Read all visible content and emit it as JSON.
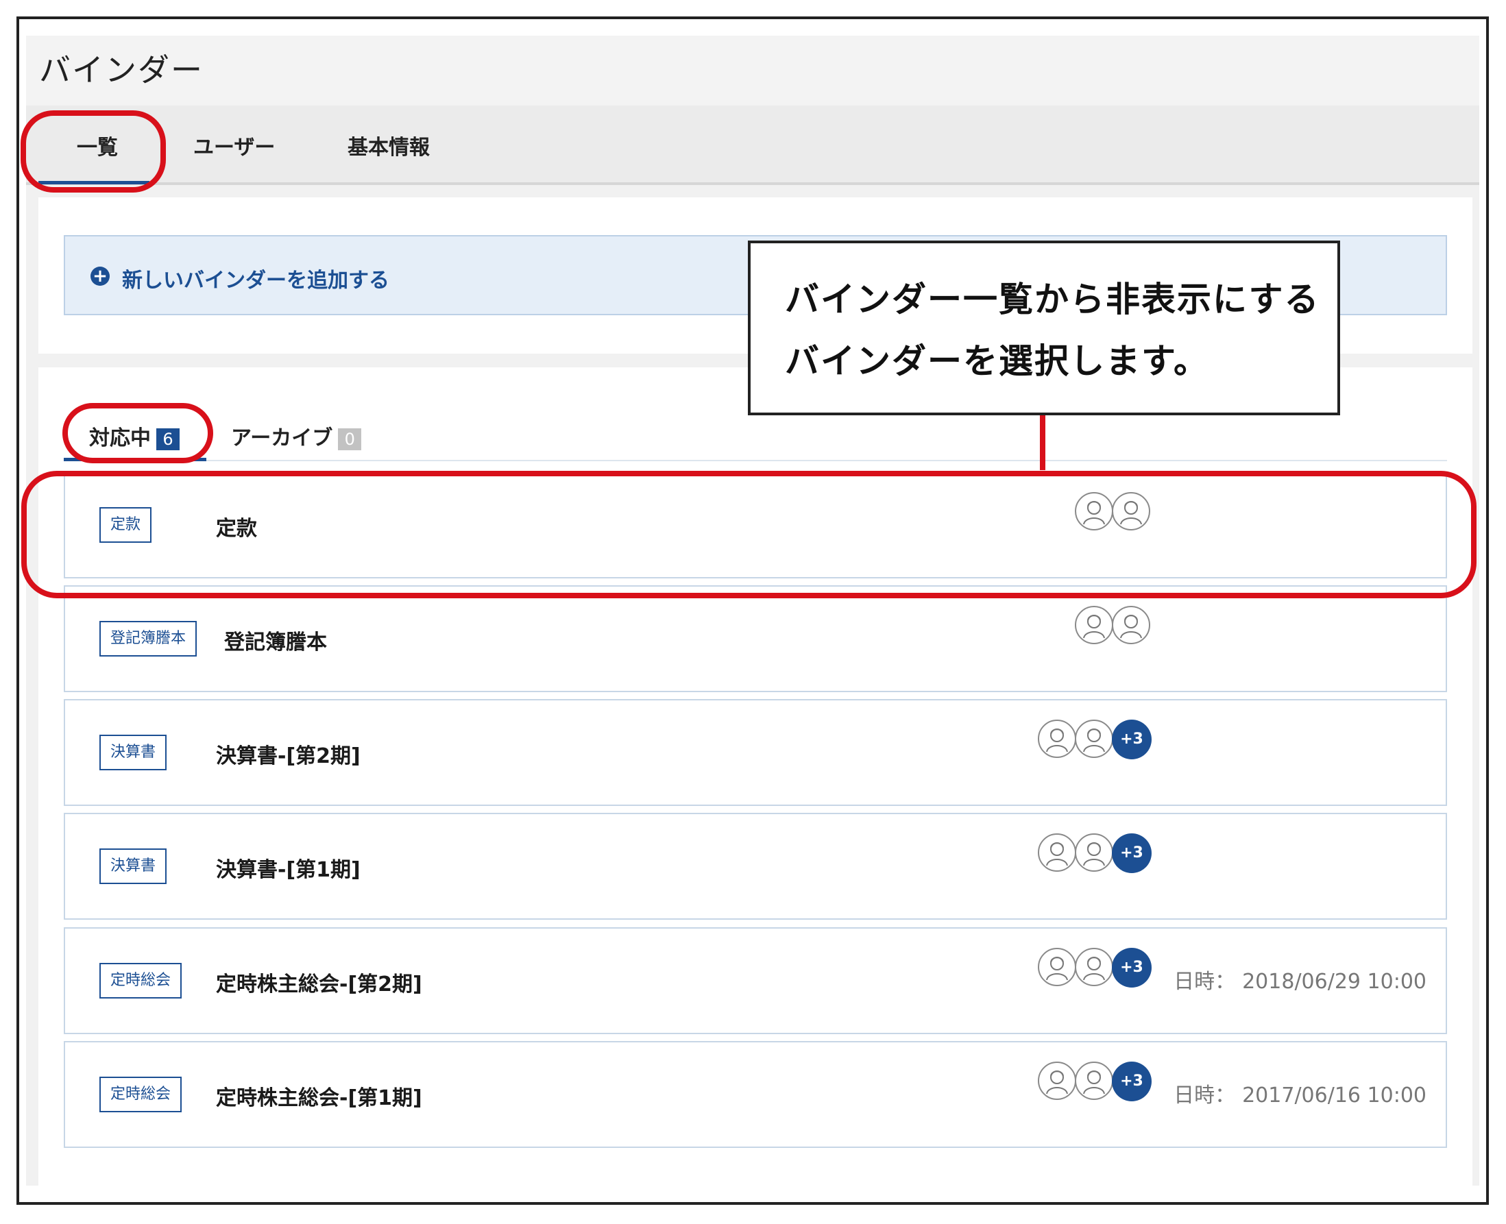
{
  "page": {
    "title": "バインダー"
  },
  "tabs": [
    {
      "label": "一覧",
      "active": true
    },
    {
      "label": "ユーザー",
      "active": false
    },
    {
      "label": "基本情報",
      "active": false
    }
  ],
  "add_binder": {
    "label": "新しいバインダーを追加する",
    "icon": "plus-circle-icon"
  },
  "subtabs": [
    {
      "label": "対応中",
      "count": "6",
      "active": true
    },
    {
      "label": "アーカイブ",
      "count": "0",
      "active": false
    }
  ],
  "binders": [
    {
      "tag": "定款",
      "title": "定款",
      "avatars": 2,
      "more": "",
      "date_label": "",
      "date": ""
    },
    {
      "tag": "登記簿謄本",
      "title": "登記簿謄本",
      "avatars": 2,
      "more": "",
      "date_label": "",
      "date": ""
    },
    {
      "tag": "決算書",
      "title": "決算書-[第2期]",
      "avatars": 2,
      "more": "+3",
      "date_label": "",
      "date": ""
    },
    {
      "tag": "決算書",
      "title": "決算書-[第1期]",
      "avatars": 2,
      "more": "+3",
      "date_label": "",
      "date": ""
    },
    {
      "tag": "定時総会",
      "title": "定時株主総会-[第2期]",
      "avatars": 2,
      "more": "+3",
      "date_label": "日時：",
      "date": "2018/06/29 10:00"
    },
    {
      "tag": "定時総会",
      "title": "定時株主総会-[第1期]",
      "avatars": 2,
      "more": "+3",
      "date_label": "日時：",
      "date": "2017/06/16 10:00"
    }
  ],
  "callout": {
    "line1": "バインダー一覧から非表示にする",
    "line2": "バインダーを選択します。"
  },
  "colors": {
    "accent": "#1c4f93",
    "highlight": "#d8101a",
    "add_bar_bg": "#e5eef8"
  }
}
